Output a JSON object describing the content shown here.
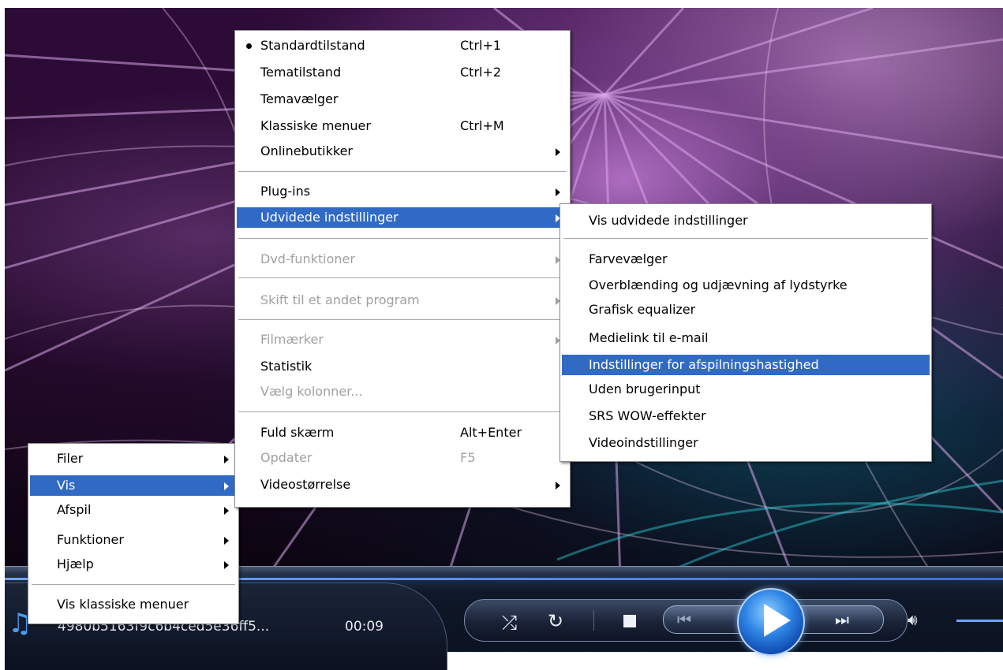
{
  "status": {
    "filename": "4980b5163f9c6b4ced5e36ff5...",
    "elapsed": "00:09"
  },
  "icons": {
    "now_playing": "music-note-icon",
    "shuffle": "shuffle-icon",
    "repeat": "repeat-icon",
    "stop": "stop-icon",
    "previous": "previous-icon",
    "play": "play-icon",
    "next": "next-icon",
    "volume": "speaker-icon"
  },
  "colors": {
    "menu_highlight": "#316ac5",
    "disabled_text": "#a0a0a0",
    "accent_blue": "#4a9ef0"
  },
  "root_menu": {
    "items": [
      {
        "label": "Filer"
      },
      {
        "label": "Vis"
      },
      {
        "label": "Afspil"
      },
      {
        "label": "Funktioner"
      },
      {
        "label": "Hjælp"
      },
      {
        "label": "Vis klassiske menuer"
      }
    ]
  },
  "vis_menu": {
    "items": [
      {
        "label": "Standardtilstand",
        "shortcut": "Ctrl+1"
      },
      {
        "label": "Tematilstand",
        "shortcut": "Ctrl+2"
      },
      {
        "label": "Temavælger"
      },
      {
        "label": "Klassiske menuer",
        "shortcut": "Ctrl+M"
      },
      {
        "label": "Onlinebutikker"
      },
      {
        "label": "Plug-ins"
      },
      {
        "label": "Udvidede indstillinger"
      },
      {
        "label": "Dvd-funktioner"
      },
      {
        "label": "Skift til et andet program"
      },
      {
        "label": "Filmærker"
      },
      {
        "label": "Statistik"
      },
      {
        "label": "Vælg kolonner..."
      },
      {
        "label": "Fuld skærm",
        "shortcut": "Alt+Enter"
      },
      {
        "label": "Opdater",
        "shortcut": "F5"
      },
      {
        "label": "Videostørrelse"
      }
    ]
  },
  "advanced_menu": {
    "items": [
      {
        "label": "Vis udvidede indstillinger"
      },
      {
        "label": "Farvevælger"
      },
      {
        "label": "Overblænding og udjævning af lydstyrke"
      },
      {
        "label": "Grafisk equalizer"
      },
      {
        "label": "Medielink til e-mail"
      },
      {
        "label": "Indstillinger for afspilningshastighed"
      },
      {
        "label": "Uden brugerinput"
      },
      {
        "label": "SRS WOW-effekter"
      },
      {
        "label": "Videoindstillinger"
      }
    ]
  }
}
